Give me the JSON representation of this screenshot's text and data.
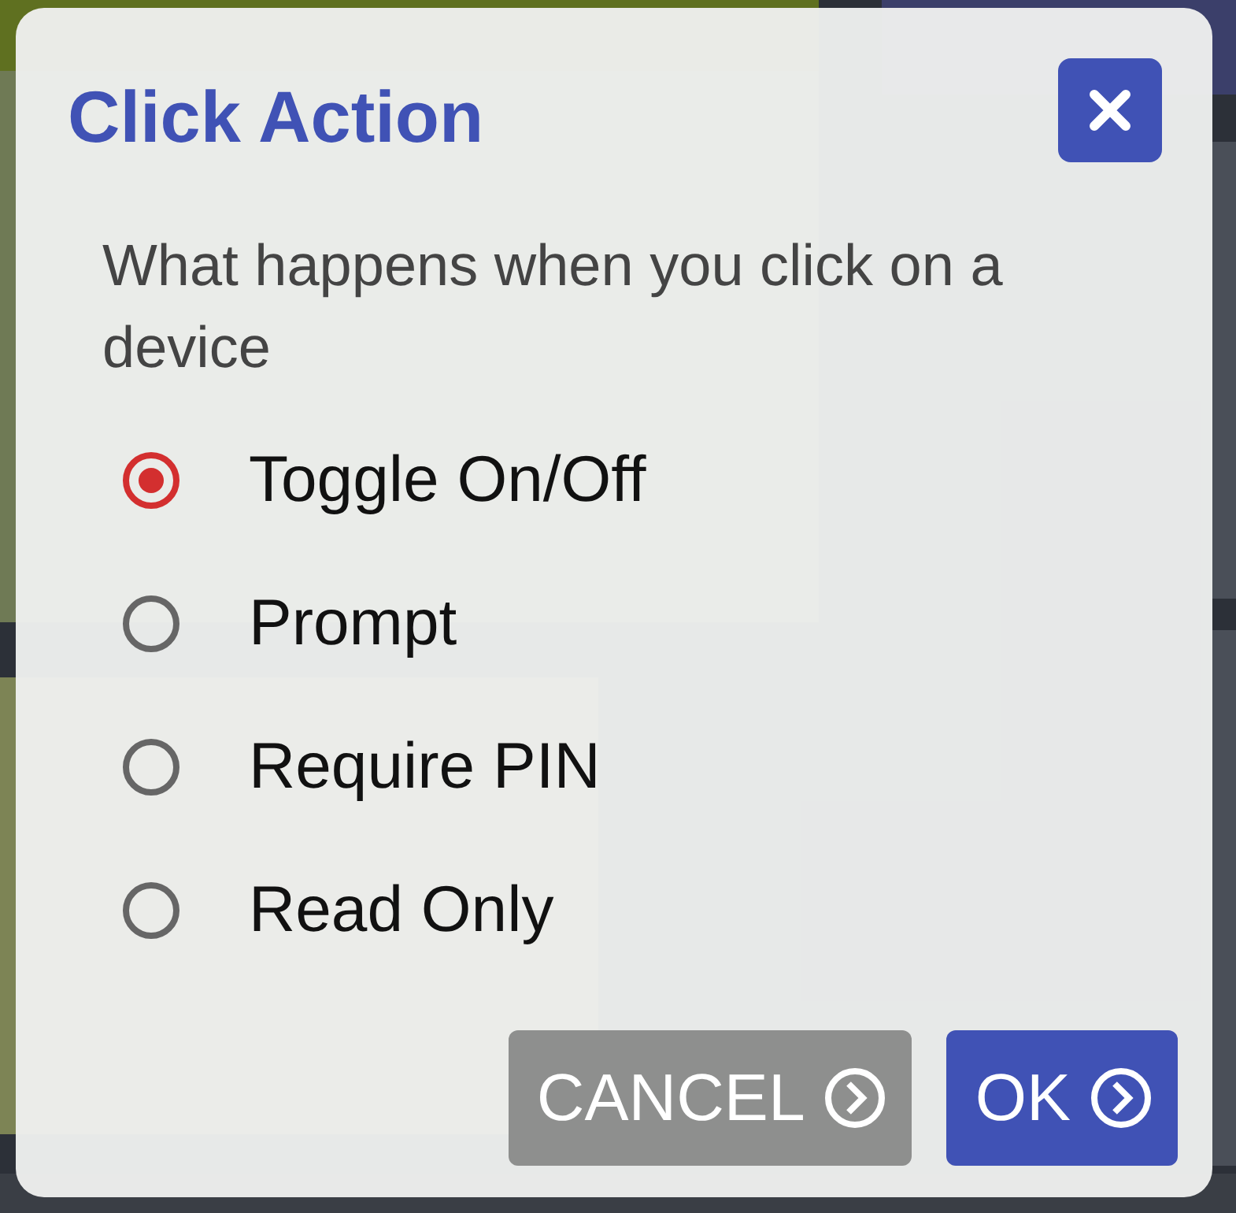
{
  "dialog": {
    "title": "Click Action",
    "question": "What happens when you click on a device",
    "options": [
      {
        "label": "Toggle On/Off",
        "selected": true
      },
      {
        "label": "Prompt",
        "selected": false
      },
      {
        "label": "Require PIN",
        "selected": false
      },
      {
        "label": "Read Only",
        "selected": false
      }
    ],
    "buttons": [
      {
        "label": "CANCEL",
        "kind": "secondary"
      },
      {
        "label": "OK",
        "kind": "primary"
      }
    ]
  }
}
